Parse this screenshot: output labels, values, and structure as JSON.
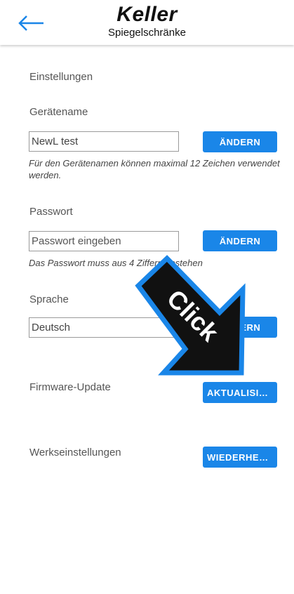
{
  "header": {
    "brand": "Keller",
    "subtitle": "Spiegelschränke",
    "back_icon": "arrow-left-icon"
  },
  "settings": {
    "title": "Einstellungen",
    "device_name": {
      "label": "Gerätename",
      "value": "NewL test",
      "button": "ÄNDERN",
      "hint": "Für den Gerätenamen können maximal 12 Zeichen verwendet werden."
    },
    "password": {
      "label": "Passwort",
      "placeholder": "Passwort eingeben",
      "button": "ÄNDERN",
      "hint": "Das Passwort muss aus 4 Ziffern bestehen"
    },
    "language": {
      "label": "Sprache",
      "value": "Deutsch",
      "button": "ÄNDERN"
    },
    "firmware": {
      "label": "Firmware-Update",
      "button": "AKTUALISIE…"
    },
    "factory": {
      "label": "Werkseinstellungen",
      "button": "WIEDERHER…"
    }
  },
  "overlay": {
    "text": "Click",
    "color": "#111111",
    "outline": "#1a86e8"
  },
  "colors": {
    "accent": "#1a86e8"
  }
}
